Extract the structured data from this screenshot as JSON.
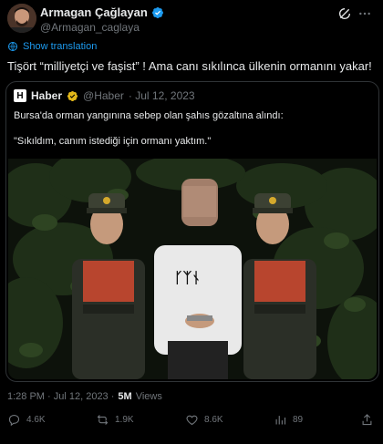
{
  "author": {
    "name": "Armagan Çağlayan",
    "handle": "@Armagan_caglaya"
  },
  "translate_label": "Show translation",
  "tweet_text": "Tişört  “milliyetçi ve faşist” !  Ama canı sıkılınca ülkenin ormanını yakar!",
  "quoted": {
    "logo_letter": "H",
    "name": "Haber",
    "handle": "@Haber",
    "date": "· Jul 12, 2023",
    "text_line1": "Bursa'da orman yangınına sebep olan şahıs gözaltına alındı:",
    "text_line2": "\"Sıkıldım, canım istediği için ormanı yaktım.\""
  },
  "meta": {
    "time_date": "1:28 PM · Jul 12, 2023 ·",
    "views_count": "5M",
    "views_label": "Views"
  },
  "actions": {
    "replies": "4.6K",
    "retweets": "1.9K",
    "likes": "8.6K",
    "views": "89"
  },
  "colors": {
    "accent": "#1d9bf0",
    "verified_gold": "#e2b719",
    "muted": "#71767b"
  }
}
